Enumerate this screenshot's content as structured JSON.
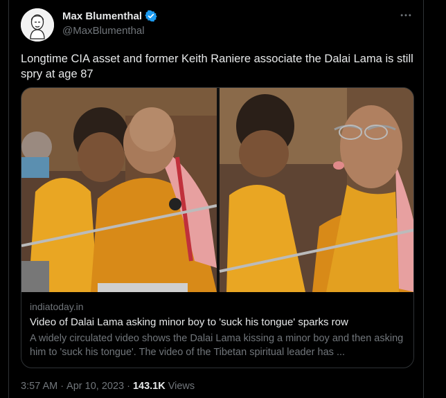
{
  "author": {
    "name": "Max Blumenthal",
    "handle": "@MaxBlumenthal",
    "verified": true
  },
  "tweet": {
    "text": "Longtime CIA asset and former Keith Raniere associate the Dalai Lama is still spry at age 87"
  },
  "link_card": {
    "domain": "indiatoday.in",
    "title": "Video of Dalai Lama asking minor boy to 'suck his tongue' sparks row",
    "description": "A widely circulated video shows the Dalai Lama kissing a minor boy and then asking him to 'suck his tongue'. The video of the Tibetan spiritual leader has ..."
  },
  "footer": {
    "time": "3:57 AM",
    "sep1": "·",
    "date": "Apr 10, 2023",
    "sep2": "·",
    "views_count": "143.1K",
    "views_label": "Views"
  },
  "icons": {
    "verified": "verified-badge-icon",
    "more": "more-horizontal-icon"
  },
  "colors": {
    "background": "#000000",
    "text_primary": "#e7e9ea",
    "text_secondary": "#71767b",
    "border": "#2f3336",
    "verified_blue": "#1d9bf0"
  }
}
